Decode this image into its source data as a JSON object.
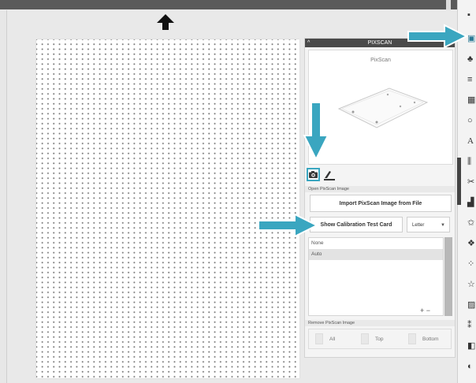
{
  "panel": {
    "title": "PIXSCAN",
    "preview_title": "PixScan",
    "open_label": "Open PixScan Image",
    "import_button": "Import PixScan Image from File",
    "calibration_button": "Show Calibration Test Card",
    "paper_size": "Letter",
    "list_items": [
      "None",
      "Auto"
    ],
    "list_add": "+",
    "list_remove": "−",
    "remove_label": "Remove PixScan Image",
    "remove_all": "All",
    "remove_top": "Top",
    "remove_bottom": "Bottom"
  },
  "colors": {
    "accent": "#3aa6c0",
    "titlebar": "#4a4a4a",
    "topbar": "#5a5a5a"
  },
  "icons": [
    "up-arrow-icon",
    "chevron-up-icon",
    "camera-icon",
    "scanner-icon",
    "dropdown-caret-icon"
  ]
}
